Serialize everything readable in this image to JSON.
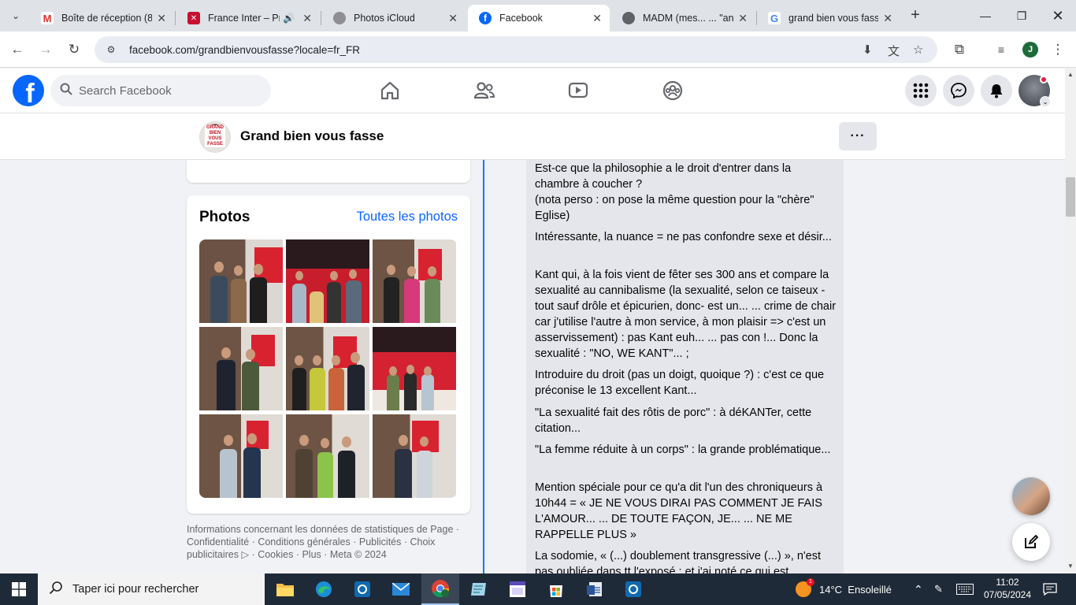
{
  "browser": {
    "tabs": [
      {
        "title": "Boîte de réception (8",
        "favicon": "gmail-icon",
        "active": false
      },
      {
        "title": "France Inter – Pre",
        "favicon": "france-inter-icon",
        "active": false,
        "audio": true
      },
      {
        "title": "Photos iCloud",
        "favicon": "apple-icon",
        "active": false
      },
      {
        "title": "Facebook",
        "favicon": "facebook-icon",
        "active": true
      },
      {
        "title": "MADM (mes... ... \"ana",
        "favicon": "globe-icon",
        "active": false
      },
      {
        "title": "grand bien vous fass",
        "favicon": "google-icon",
        "active": false
      }
    ],
    "url": "facebook.com/grandbienvousfasse?locale=fr_FR",
    "profile_initial": "J"
  },
  "facebook": {
    "search_placeholder": "Search Facebook",
    "page_name": "Grand bien vous fasse",
    "page_avatar_text": "GRAND BIEN VOUS FASSE",
    "photos": {
      "title": "Photos",
      "link": "Toutes les photos"
    },
    "footer": {
      "line1": "Informations concernant les données de statistiques de Page ·",
      "line2": "Confidentialité · Conditions générales · Publicités · Choix",
      "line3": "publicitaires ▷ · Cookies · Plus · Meta © 2024"
    },
    "comment_paragraphs": [
      "Est-ce que la philosophie a le droit d'entrer dans la chambre à coucher ?\n(nota perso : on pose la même question pour la \"chère\" Eglise)",
      "Intéressante, la nuance = ne pas confondre sexe et désir...",
      "Kant qui, à la fois vient de fêter ses 300 ans et compare la sexualité au cannibalisme (la sexualité, selon ce taiseux - tout sauf drôle et épicurien, donc- est un... ... crime de chair car j'utilise l'autre à mon service, à mon plaisir => c'est un asservissement) : pas Kant euh... ... pas con !... Donc la sexualité : \"NO, WE KANT\"... ;",
      "Introduire du droit (pas un doigt, quoique ?) : c'est ce que préconise le 13 excellent Kant...",
      "\"La sexualité fait des rôtis de porc\" : à déKANTer, cette citation...",
      "\"La femme réduite à un corps\" : la grande problématique...",
      "Mention spéciale pour ce qu'a dit l'un des chroniqueurs à 10h44 = « JE NE VOUS DIRAI PAS COMMENT JE FAIS L'AMOUR... ... DE TOUTE FAÇON, JE... ... NE ME RAPPELLE PLUS »",
      "La sodomie, « (...) doublement transgressive (...) », n'est pas oubliée dans tt l'exposé : et j'ai noté ce qui est"
    ]
  },
  "taskbar": {
    "search_placeholder": "Taper ici pour rechercher",
    "weather": "14°C  Ensoleillé",
    "time": "11:02",
    "date": "07/05/2024"
  },
  "colors": {
    "facebook_blue": "#0866ff",
    "taskbar": "#1f2a38",
    "tab_strip": "#dfe3e8"
  }
}
